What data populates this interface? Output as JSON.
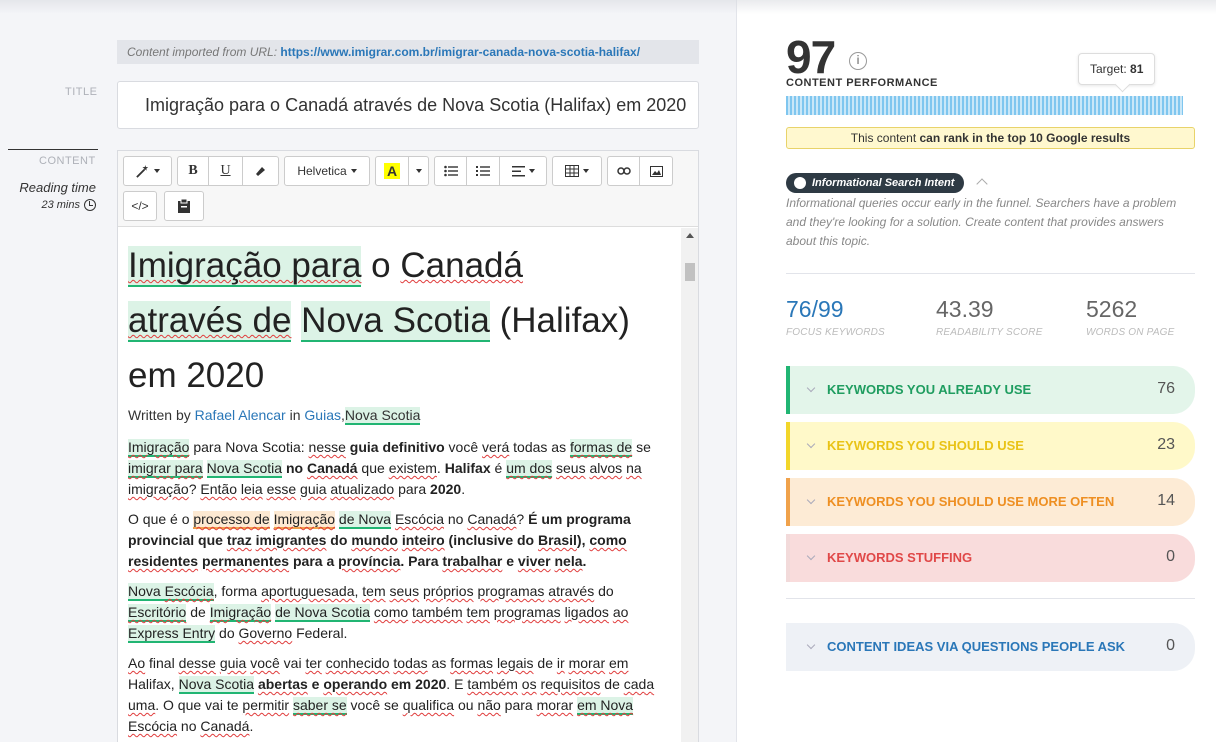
{
  "import_bar": {
    "prefix": "Content imported from URL:",
    "url": "https://www.imigrar.com.br/imigrar-canada-nova-scotia-halifax/"
  },
  "labels": {
    "title": "TITLE",
    "content": "CONTENT",
    "reading_time": "Reading time",
    "reading_mins": "23 mins"
  },
  "title_value": "Imigração para o Canadá através de Nova Scotia (Halifax) em 2020",
  "toolbar": {
    "font": "Helvetica",
    "bold": "B",
    "underline": "U",
    "highlight": "A",
    "code": "</>"
  },
  "doc": {
    "h1_parts": [
      "Imigração para",
      " o ",
      "Canadá",
      "através de",
      " ",
      "Nova Scotia",
      " (Halifax) em 2020"
    ],
    "byline": {
      "prefix": "Written by ",
      "author": "Rafael Alencar",
      "in": " in ",
      "cat1": "Guias",
      "comma": ",",
      "cat2": "Nova Scotia"
    }
  },
  "right": {
    "score": "97",
    "perf_label": "CONTENT PERFORMANCE",
    "target_label": "Target:",
    "target_value": "81",
    "performance_fill": 0.97,
    "rank_prefix": "This content ",
    "rank_bold": "can rank in the top 10 Google results",
    "intent": "Informational Search Intent",
    "intent_desc": "Informational queries occur early in the funnel. Searchers have a problem and they're looking for a solution. Create content that provides answers about this topic.",
    "stats": {
      "focus_num": "76",
      "focus_den": "/99",
      "focus_label": "FOCUS KEYWORDS",
      "readability": "43.39",
      "readability_label": "READABILITY SCORE",
      "words": "5262",
      "words_label": "WORDS ON PAGE"
    },
    "keywords": [
      {
        "label": "KEYWORDS YOU ALREADY USE",
        "count": "76",
        "color": "#21b573",
        "bg": "#e3f5ea",
        "text": "#1f9d60"
      },
      {
        "label": "KEYWORDS YOU SHOULD USE",
        "count": "23",
        "color": "#f2d62a",
        "bg": "#fff9c9",
        "text": "#e9c316"
      },
      {
        "label": "KEYWORDS YOU SHOULD USE MORE OFTEN",
        "count": "14",
        "color": "#f0a24b",
        "bg": "#fdebd5",
        "text": "#ee8f22"
      },
      {
        "label": "KEYWORDS STUFFING",
        "count": "0",
        "color": "#f2dada",
        "bg": "#f9dcdc",
        "text": "#e04848"
      }
    ],
    "questions": {
      "label": "CONTENT IDEAS VIA QUESTIONS PEOPLE ASK",
      "count": "0",
      "text": "#2a77b8",
      "bg": "#eef1f6"
    }
  }
}
